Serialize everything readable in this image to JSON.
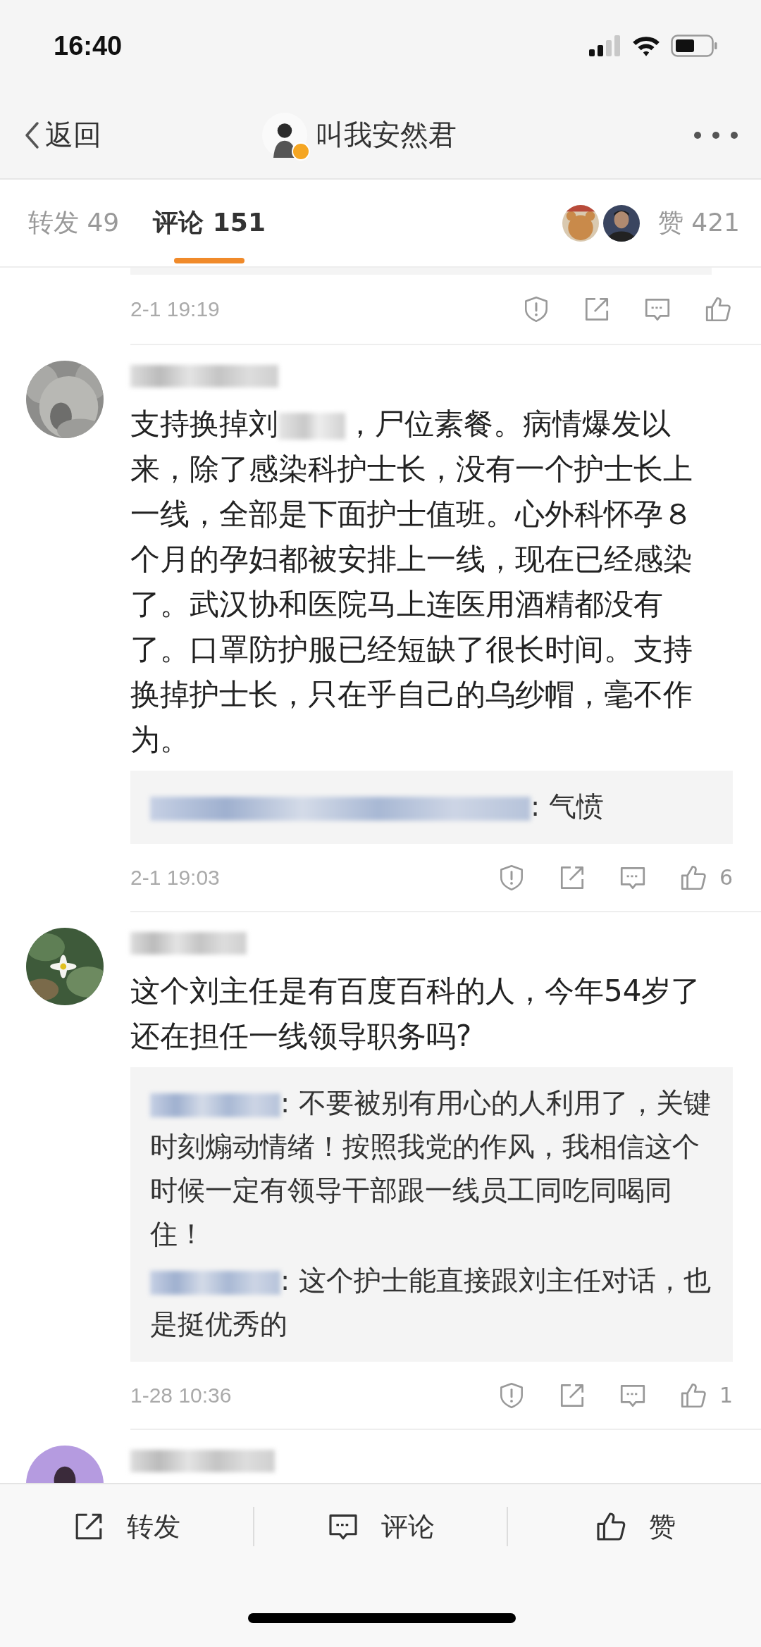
{
  "status_bar": {
    "time": "16:40"
  },
  "nav": {
    "back": "返回",
    "title": "叫我安然君",
    "verified": true
  },
  "tabs": [
    {
      "label": "转发",
      "count": "49",
      "selected": false
    },
    {
      "label": "评论",
      "count": "151",
      "selected": true
    }
  ],
  "likes": {
    "label": "赞",
    "count": "421"
  },
  "previous_comment": {
    "time": "2-1 19:19"
  },
  "comments": [
    {
      "text": [
        "支持换掉刘",
        "，尸位素餐。病情爆发以来，除了感染科护士长，没有一个护士长上一线，全部是下面护士值班。心外科怀孕８个月的孕妇都被安排上一线，现在已经感染了。武汉协和医院马上连医用酒精都没有了。口罩防护服已经短缺了很长时间。支持换掉护士长，只在乎自己的乌纱帽，毫不作为。"
      ],
      "replies": [
        {
          "text": ": 气愤"
        }
      ],
      "time": "2-1 19:03",
      "like_count": "6"
    },
    {
      "text": [
        "这个刘主任是有百度百科的人，今年54岁了还在担任一线领导职务吗?"
      ],
      "replies": [
        {
          "text": ": 不要被别有用心的人利用了，关键时刻煽动情绪！按照我党的作风，我相信这个时候一定有领导干部跟一线员工同吃同喝同住！"
        },
        {
          "text": ": 这个护士能直接跟刘主任对话，也是挺优秀的"
        }
      ],
      "time": "1-28 10:36",
      "like_count": "1"
    }
  ],
  "more_below": true,
  "bottom_bar": [
    {
      "kind": "repost",
      "label": "转发"
    },
    {
      "kind": "comment",
      "label": "评论"
    },
    {
      "kind": "like",
      "label": "赞"
    }
  ]
}
